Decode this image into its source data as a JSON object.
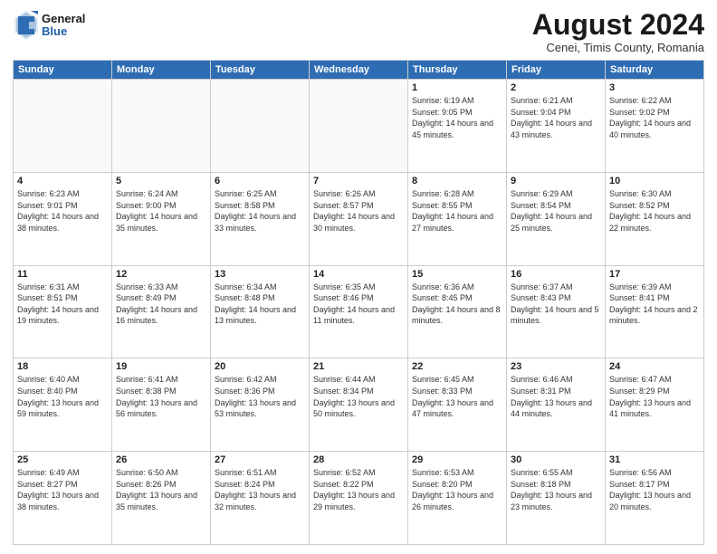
{
  "logo": {
    "line1": "General",
    "line2": "Blue"
  },
  "header": {
    "month": "August 2024",
    "location": "Cenei, Timis County, Romania"
  },
  "weekdays": [
    "Sunday",
    "Monday",
    "Tuesday",
    "Wednesday",
    "Thursday",
    "Friday",
    "Saturday"
  ],
  "weeks": [
    [
      {
        "day": "",
        "info": ""
      },
      {
        "day": "",
        "info": ""
      },
      {
        "day": "",
        "info": ""
      },
      {
        "day": "",
        "info": ""
      },
      {
        "day": "1",
        "info": "Sunrise: 6:19 AM\nSunset: 9:05 PM\nDaylight: 14 hours and 45 minutes."
      },
      {
        "day": "2",
        "info": "Sunrise: 6:21 AM\nSunset: 9:04 PM\nDaylight: 14 hours and 43 minutes."
      },
      {
        "day": "3",
        "info": "Sunrise: 6:22 AM\nSunset: 9:02 PM\nDaylight: 14 hours and 40 minutes."
      }
    ],
    [
      {
        "day": "4",
        "info": "Sunrise: 6:23 AM\nSunset: 9:01 PM\nDaylight: 14 hours and 38 minutes."
      },
      {
        "day": "5",
        "info": "Sunrise: 6:24 AM\nSunset: 9:00 PM\nDaylight: 14 hours and 35 minutes."
      },
      {
        "day": "6",
        "info": "Sunrise: 6:25 AM\nSunset: 8:58 PM\nDaylight: 14 hours and 33 minutes."
      },
      {
        "day": "7",
        "info": "Sunrise: 6:26 AM\nSunset: 8:57 PM\nDaylight: 14 hours and 30 minutes."
      },
      {
        "day": "8",
        "info": "Sunrise: 6:28 AM\nSunset: 8:55 PM\nDaylight: 14 hours and 27 minutes."
      },
      {
        "day": "9",
        "info": "Sunrise: 6:29 AM\nSunset: 8:54 PM\nDaylight: 14 hours and 25 minutes."
      },
      {
        "day": "10",
        "info": "Sunrise: 6:30 AM\nSunset: 8:52 PM\nDaylight: 14 hours and 22 minutes."
      }
    ],
    [
      {
        "day": "11",
        "info": "Sunrise: 6:31 AM\nSunset: 8:51 PM\nDaylight: 14 hours and 19 minutes."
      },
      {
        "day": "12",
        "info": "Sunrise: 6:33 AM\nSunset: 8:49 PM\nDaylight: 14 hours and 16 minutes."
      },
      {
        "day": "13",
        "info": "Sunrise: 6:34 AM\nSunset: 8:48 PM\nDaylight: 14 hours and 13 minutes."
      },
      {
        "day": "14",
        "info": "Sunrise: 6:35 AM\nSunset: 8:46 PM\nDaylight: 14 hours and 11 minutes."
      },
      {
        "day": "15",
        "info": "Sunrise: 6:36 AM\nSunset: 8:45 PM\nDaylight: 14 hours and 8 minutes."
      },
      {
        "day": "16",
        "info": "Sunrise: 6:37 AM\nSunset: 8:43 PM\nDaylight: 14 hours and 5 minutes."
      },
      {
        "day": "17",
        "info": "Sunrise: 6:39 AM\nSunset: 8:41 PM\nDaylight: 14 hours and 2 minutes."
      }
    ],
    [
      {
        "day": "18",
        "info": "Sunrise: 6:40 AM\nSunset: 8:40 PM\nDaylight: 13 hours and 59 minutes."
      },
      {
        "day": "19",
        "info": "Sunrise: 6:41 AM\nSunset: 8:38 PM\nDaylight: 13 hours and 56 minutes."
      },
      {
        "day": "20",
        "info": "Sunrise: 6:42 AM\nSunset: 8:36 PM\nDaylight: 13 hours and 53 minutes."
      },
      {
        "day": "21",
        "info": "Sunrise: 6:44 AM\nSunset: 8:34 PM\nDaylight: 13 hours and 50 minutes."
      },
      {
        "day": "22",
        "info": "Sunrise: 6:45 AM\nSunset: 8:33 PM\nDaylight: 13 hours and 47 minutes."
      },
      {
        "day": "23",
        "info": "Sunrise: 6:46 AM\nSunset: 8:31 PM\nDaylight: 13 hours and 44 minutes."
      },
      {
        "day": "24",
        "info": "Sunrise: 6:47 AM\nSunset: 8:29 PM\nDaylight: 13 hours and 41 minutes."
      }
    ],
    [
      {
        "day": "25",
        "info": "Sunrise: 6:49 AM\nSunset: 8:27 PM\nDaylight: 13 hours and 38 minutes."
      },
      {
        "day": "26",
        "info": "Sunrise: 6:50 AM\nSunset: 8:26 PM\nDaylight: 13 hours and 35 minutes."
      },
      {
        "day": "27",
        "info": "Sunrise: 6:51 AM\nSunset: 8:24 PM\nDaylight: 13 hours and 32 minutes."
      },
      {
        "day": "28",
        "info": "Sunrise: 6:52 AM\nSunset: 8:22 PM\nDaylight: 13 hours and 29 minutes."
      },
      {
        "day": "29",
        "info": "Sunrise: 6:53 AM\nSunset: 8:20 PM\nDaylight: 13 hours and 26 minutes."
      },
      {
        "day": "30",
        "info": "Sunrise: 6:55 AM\nSunset: 8:18 PM\nDaylight: 13 hours and 23 minutes."
      },
      {
        "day": "31",
        "info": "Sunrise: 6:56 AM\nSunset: 8:17 PM\nDaylight: 13 hours and 20 minutes."
      }
    ]
  ]
}
